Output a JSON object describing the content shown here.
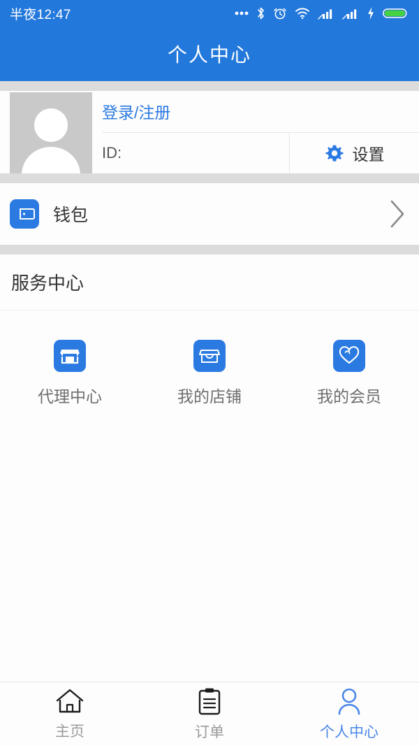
{
  "statusbar": {
    "time": "半夜12:47",
    "icons": [
      "more-dots-icon",
      "bluetooth-icon",
      "alarm-clock-icon",
      "wifi-icon",
      "signal-bars-icon",
      "signal-bars-2-icon",
      "charging-bolt-icon",
      "battery-icon"
    ]
  },
  "header": {
    "title": "个人中心",
    "bg_color": "#2378DC"
  },
  "profile": {
    "avatar_icon": "person-placeholder-icon",
    "login_label": "登录/注册",
    "login_color": "#2a7ae2",
    "id_label": "ID:",
    "settings_label": "设置",
    "settings_icon": "gear-icon"
  },
  "wallet": {
    "label": "钱包",
    "icon": "wallet-icon",
    "chevron_icon": "chevron-right-icon"
  },
  "service_center": {
    "title": "服务中心",
    "items": [
      {
        "label": "代理中心",
        "icon": "storefront-filled-icon"
      },
      {
        "label": "我的店铺",
        "icon": "storefront-outline-icon"
      },
      {
        "label": "我的会员",
        "icon": "heart-outline-icon"
      }
    ]
  },
  "tabbar": {
    "active_color": "#4a87e8",
    "inactive_color": "#9a9a9a",
    "items": [
      {
        "label": "主页",
        "icon": "home-icon",
        "active": false
      },
      {
        "label": "订单",
        "icon": "clipboard-icon",
        "active": false
      },
      {
        "label": "个人中心",
        "icon": "person-icon",
        "active": true
      }
    ]
  }
}
